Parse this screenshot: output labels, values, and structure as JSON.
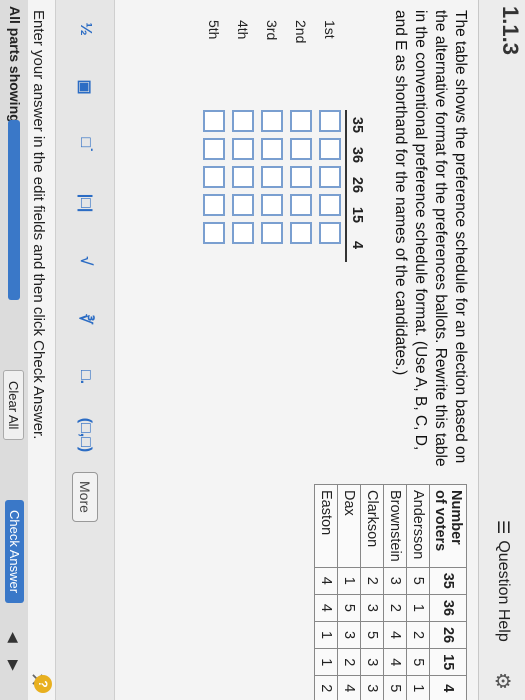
{
  "header": {
    "question_number": "1.1.3",
    "help_label": "Question Help"
  },
  "instructions": "The table shows the preference schedule for an election based on the alternative format for the preferences ballots. Rewrite this table in the conventional preference schedule format. (Use A, B, C, D, and E as shorthand for the names of the candidates.)",
  "pref_table": {
    "header": "Number of voters",
    "voters": [
      "35",
      "36",
      "26",
      "15",
      "4"
    ],
    "rows": [
      {
        "name": "Andersson",
        "values": [
          "5",
          "1",
          "2",
          "5",
          "1"
        ]
      },
      {
        "name": "Brownstein",
        "values": [
          "3",
          "2",
          "4",
          "4",
          "5"
        ]
      },
      {
        "name": "Clarkson",
        "values": [
          "2",
          "3",
          "5",
          "3",
          "3"
        ]
      },
      {
        "name": "Dax",
        "values": [
          "1",
          "5",
          "3",
          "2",
          "4"
        ]
      },
      {
        "name": "Easton",
        "values": [
          "4",
          "4",
          "1",
          "1",
          "2"
        ]
      }
    ]
  },
  "entry": {
    "voters": [
      "35",
      "36",
      "26",
      "15",
      "4"
    ],
    "ranks": [
      "1st",
      "2nd",
      "3rd",
      "4th",
      "5th"
    ]
  },
  "toolbar": {
    "more_label": "More"
  },
  "prompt": "Enter your answer in the edit fields and then click Check Answer.",
  "footer": {
    "parts_label": "All parts showing",
    "clear_label": "Clear All",
    "check_label": "Check Answer"
  },
  "colors": {
    "accent": "#3a78c8",
    "input_border": "#7a9fd0"
  }
}
